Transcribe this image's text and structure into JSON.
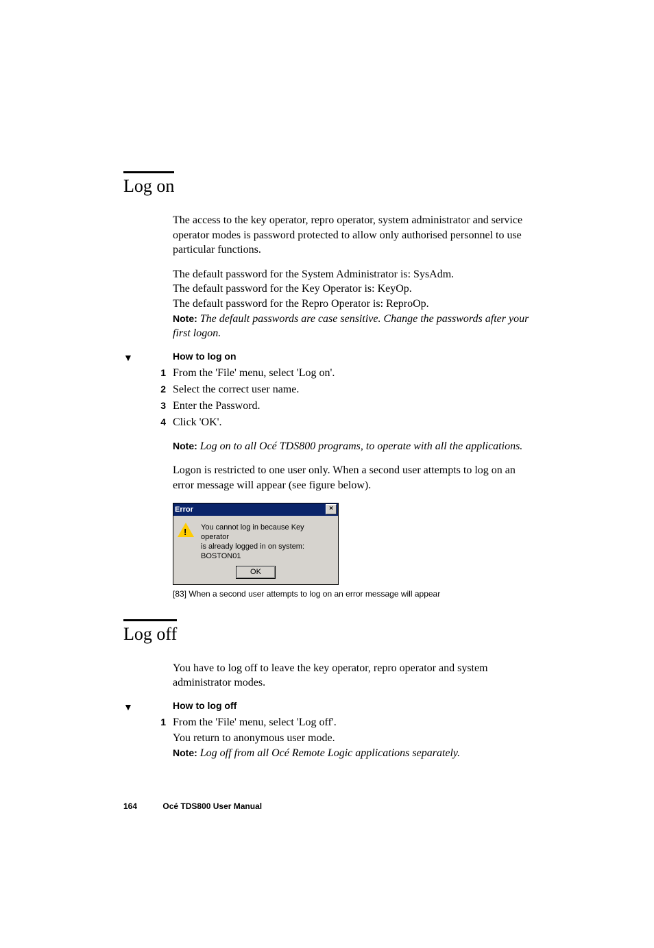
{
  "section1": {
    "heading": "Log on",
    "intro": "The access to the key operator, repro operator, system administrator and service operator modes is password protected to allow only authorised personnel to use particular functions.",
    "defaults": {
      "line1": "The default password for the System Administrator is: SysAdm.",
      "line2": "The default password for the Key Operator is: KeyOp.",
      "line3": "The default password for the Repro Operator is: ReproOp.",
      "note_label": "Note:",
      "note_text": "The default passwords are case sensitive. Change the passwords after your first logon."
    },
    "procedure": {
      "marker": "▼",
      "title": "How to log on",
      "steps": [
        {
          "n": "1",
          "text": "From the 'File' menu, select 'Log on'."
        },
        {
          "n": "2",
          "text": "Select the correct user name."
        },
        {
          "n": "3",
          "text": "Enter the Password."
        },
        {
          "n": "4",
          "text": "Click 'OK'."
        }
      ],
      "post_note_label": "Note:",
      "post_note_text": "Log on to all Océ TDS800 programs, to operate with all the applications."
    },
    "restriction": "Logon is restricted to one user only. When a second user attempts to log on an error message will appear (see figure below).",
    "dialog": {
      "title": "Error",
      "msg_line1": "You cannot log in because Key operator",
      "msg_line2": "is already logged in on system: BOSTON01",
      "ok": "OK"
    },
    "caption": "[83] When a second user attempts to log on an error message will appear"
  },
  "section2": {
    "heading": "Log off",
    "intro": "You have to log off to leave the key operator, repro operator and system administrator modes.",
    "procedure": {
      "marker": "▼",
      "title": "How to log off",
      "steps": [
        {
          "n": "1",
          "text": "From the 'File' menu, select 'Log off'."
        }
      ],
      "after_step": "You return to anonymous user mode.",
      "note_label": "Note:",
      "note_text": "Log off from all Océ Remote Logic applications separately."
    }
  },
  "footer": {
    "page": "164",
    "doc": "Océ TDS800 User Manual"
  }
}
